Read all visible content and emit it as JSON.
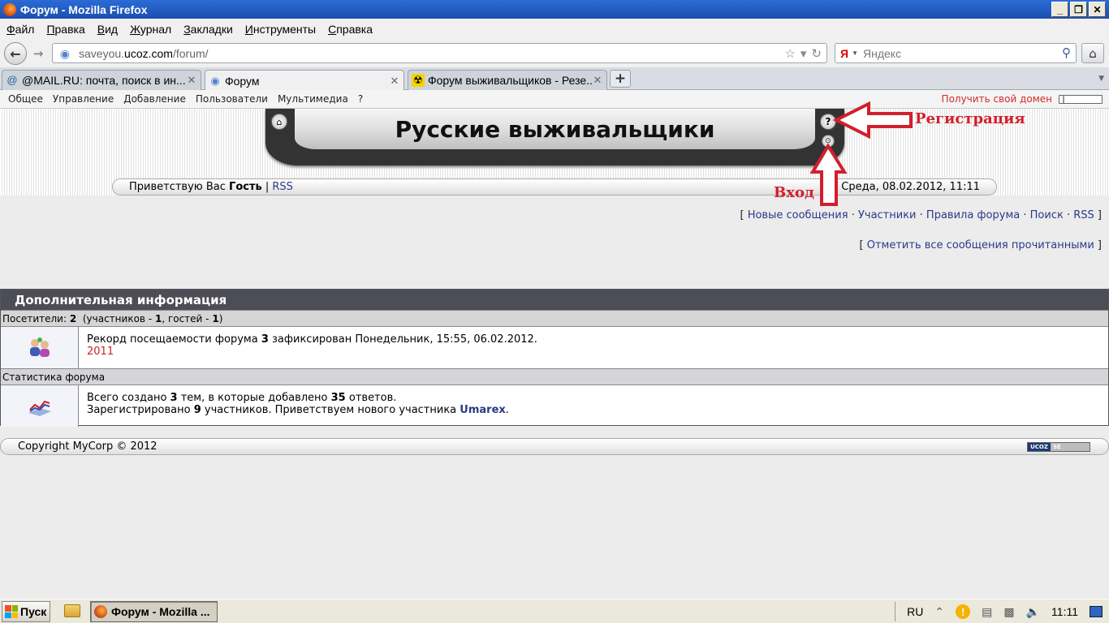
{
  "window": {
    "title": "Форум - Mozilla Firefox",
    "min": "_",
    "max": "❐",
    "close": "✕"
  },
  "menubar": [
    "Файл",
    "Правка",
    "Вид",
    "Журнал",
    "Закладки",
    "Инструменты",
    "Справка"
  ],
  "urlbar": {
    "prefix": "saveyou.",
    "domain": "ucoz.com",
    "suffix": "/forum/"
  },
  "search": {
    "placeholder": "Яндекс",
    "engine_icon": "Я"
  },
  "tabs": [
    {
      "label": "@MAIL.RU: почта, поиск в ин...",
      "icon": "mailru-icon"
    },
    {
      "label": "Форум",
      "icon": "ucoz-icon"
    },
    {
      "label": "Форум выживальщиков - Резе...",
      "icon": "radiation-icon"
    }
  ],
  "admin": {
    "items": [
      "Общее",
      "Управление",
      "Добавление",
      "Пользователи",
      "Мультимедиа",
      "?"
    ],
    "domain_link": "Получить свой домен"
  },
  "site": {
    "title": "Русские выживальщики",
    "greeting_prefix": "Приветствую Вас",
    "greeting_user": "Гость",
    "rss": "RSS",
    "datetime": "Среда, 08.02.2012, 11:11"
  },
  "annotations": {
    "register": "Регистрация",
    "login": "Вход"
  },
  "links": {
    "row1": [
      "Новые сообщения",
      "Участники",
      "Правила форума",
      "Поиск",
      "RSS"
    ],
    "mark_read": "Отметить все сообщения прочитанными"
  },
  "info": {
    "header": "Дополнительная информация",
    "visitors_label": "Посетители:",
    "visitors_total": "2",
    "participants_label": "(участников -",
    "participants": "1",
    "guests_label": ", гостей -",
    "guests": "1",
    "record_text": "Рекорд посещаемости форума",
    "record_num": "3",
    "record_rest": "зафиксирован Понедельник, 15:55, 06.02.2012.",
    "record_user": "2011",
    "stats_label": "Статистика форума",
    "stats_p1": "Всего создано",
    "topics": "3",
    "stats_p2": "тем, в которые добавлено",
    "replies": "35",
    "stats_p3": "ответов.",
    "reg_p1": "Зарегистрировано",
    "members": "9",
    "reg_p2": "участников. Приветствуем нового участника",
    "newest": "Umarex"
  },
  "footer": {
    "copyright": "Copyright MyCorp © 2012",
    "badge_a": "UCOZ",
    "badge_b": "SE"
  },
  "taskbar": {
    "start": "Пуск",
    "task": "Форум - Mozilla ...",
    "lang": "RU",
    "time": "11:11"
  },
  "colors": {
    "accent_red": "#d21f2c",
    "header_dark": "#4d4d57",
    "link": "#2b3a86"
  }
}
